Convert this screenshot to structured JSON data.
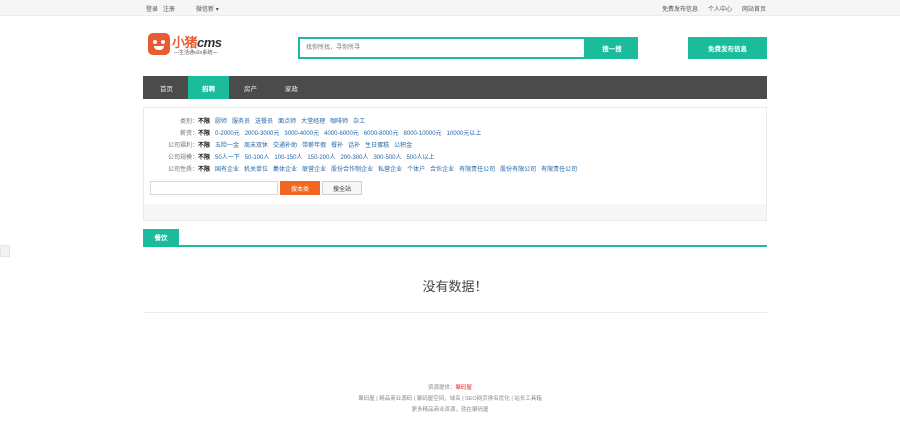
{
  "topbar": {
    "login": "登录",
    "register": "注册",
    "wechat": "微信新 ▾",
    "right": [
      "免费发布信息",
      "个人中心",
      "网站首页"
    ]
  },
  "logo": {
    "title_cn": "小猪",
    "title_en": "cms",
    "subtitle": "—生活通o2o系统—"
  },
  "search": {
    "placeholder": "找你所找，寻你所寻",
    "button": "搜一搜"
  },
  "post_button": "免费发布信息",
  "nav": [
    "首页",
    "招聘",
    "房产",
    "家政"
  ],
  "nav_active": 1,
  "filters": [
    {
      "label": "类别：",
      "selected": "不限",
      "options": [
        "厨师",
        "服务员",
        "送餐员",
        "面点师",
        "大堂经理",
        "咖啡师",
        "杂工"
      ]
    },
    {
      "label": "薪资：",
      "selected": "不限",
      "options": [
        "0-2000元",
        "2000-3000元",
        "3000-4000元",
        "4000-6000元",
        "6000-8000元",
        "8000-10000元",
        "10000元以上"
      ]
    },
    {
      "label": "公司福利：",
      "selected": "不限",
      "options": [
        "五险一金",
        "周末双休",
        "交通补助",
        "带薪年假",
        "餐补",
        "话补",
        "生日蛋糕",
        "公积金"
      ]
    },
    {
      "label": "公司规模：",
      "selected": "不限",
      "options": [
        "50人一下",
        "50-100人",
        "100-150人",
        "150-200人",
        "200-300人",
        "300-500人",
        "500人以上"
      ]
    },
    {
      "label": "公司性质：",
      "selected": "不限",
      "options": [
        "国有企业",
        "机关单位",
        "集体企业",
        "联营企业",
        "股份合作制企业",
        "私营企业",
        "个体户",
        "合伙企业",
        "有限责任公司",
        "股份有限公司",
        "有限责任公司"
      ]
    }
  ],
  "buttons": {
    "search_local": "搜本类",
    "search_all": "搜全站"
  },
  "category_tab": "餐饮",
  "empty_message": "没有数据！",
  "footer": {
    "line1_prefix": "资源提供：",
    "line1_link": "聚码屋",
    "line2": "聚码屋 | 精品商业源码 | 聚码屋空间，域名 | SEO网页排名优化 | 站长工具箱",
    "line3": "更多精品商业资源，就在聚码屋"
  },
  "colors": {
    "accent": "#1bbc9b",
    "nav_bg": "#4b4b4b",
    "orange": "#f0681f",
    "link": "#2466a8"
  }
}
